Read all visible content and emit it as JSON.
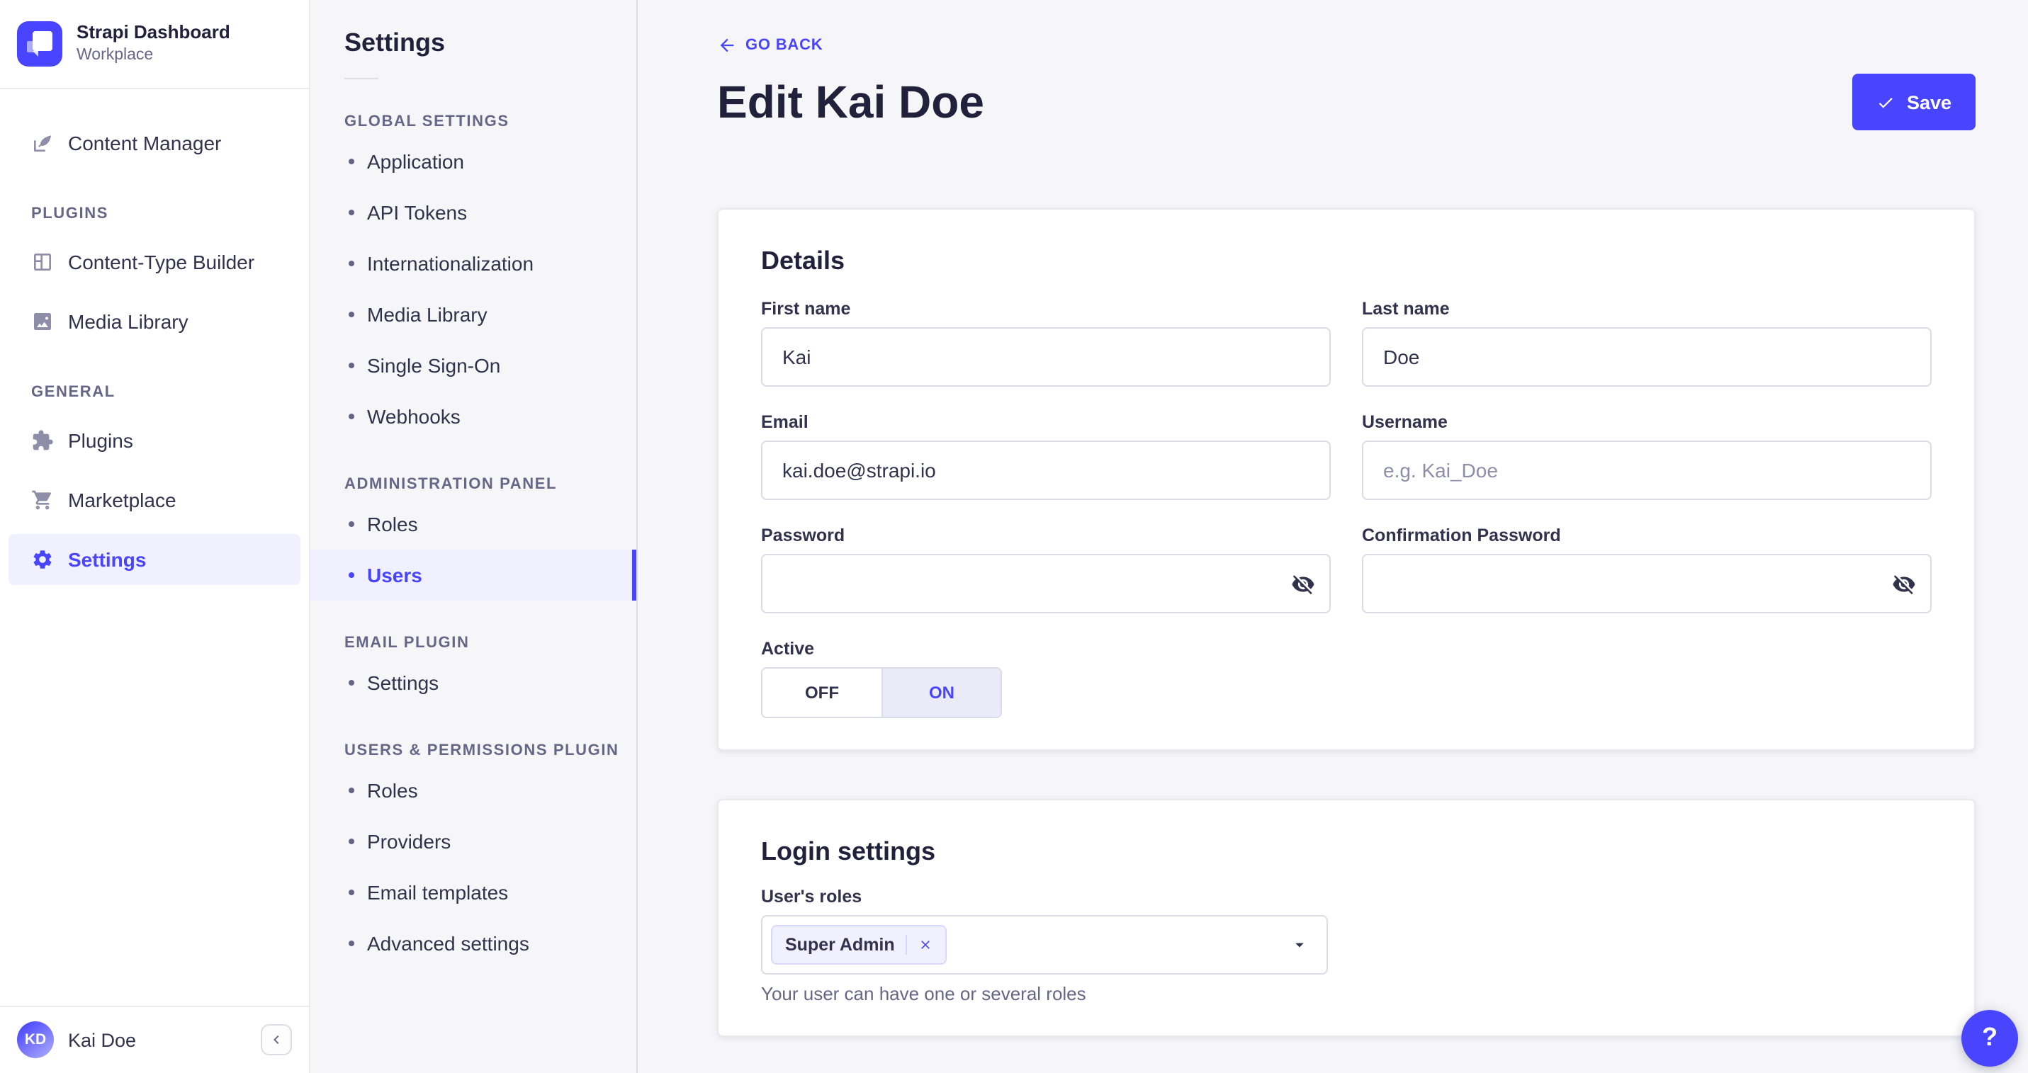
{
  "colors": {
    "primary": "#4945FF",
    "primary_light": "#F0F0FF",
    "text_dark": "#21213B",
    "text": "#32324D",
    "text_muted": "#666687",
    "border": "#DCDCE4",
    "background": "#F6F6F9"
  },
  "sidebar": {
    "brand": {
      "title": "Strapi Dashboard",
      "subtitle": "Workplace"
    },
    "top_items": [
      {
        "label": "Content Manager"
      }
    ],
    "sections": [
      {
        "title": "PLUGINS",
        "items": [
          {
            "label": "Content-Type Builder"
          },
          {
            "label": "Media Library"
          }
        ]
      },
      {
        "title": "GENERAL",
        "items": [
          {
            "label": "Plugins"
          },
          {
            "label": "Marketplace"
          },
          {
            "label": "Settings"
          }
        ]
      }
    ],
    "user": {
      "initials": "KD",
      "name": "Kai Doe"
    }
  },
  "subnav": {
    "title": "Settings",
    "sections": [
      {
        "title": "GLOBAL SETTINGS",
        "items": [
          {
            "label": "Application"
          },
          {
            "label": "API Tokens"
          },
          {
            "label": "Internationalization"
          },
          {
            "label": "Media Library"
          },
          {
            "label": "Single Sign-On"
          },
          {
            "label": "Webhooks"
          }
        ]
      },
      {
        "title": "ADMINISTRATION PANEL",
        "items": [
          {
            "label": "Roles"
          },
          {
            "label": "Users"
          }
        ]
      },
      {
        "title": "EMAIL PLUGIN",
        "items": [
          {
            "label": "Settings"
          }
        ]
      },
      {
        "title": "USERS & PERMISSIONS PLUGIN",
        "items": [
          {
            "label": "Roles"
          },
          {
            "label": "Providers"
          },
          {
            "label": "Email templates"
          },
          {
            "label": "Advanced settings"
          }
        ]
      }
    ]
  },
  "header": {
    "back_label": "GO BACK",
    "title": "Edit Kai Doe",
    "save_label": "Save"
  },
  "details": {
    "title": "Details",
    "fields": [
      {
        "label": "First name",
        "value": "Kai"
      },
      {
        "label": "Last name",
        "value": "Doe"
      },
      {
        "label": "Email",
        "value": "kai.doe@strapi.io"
      },
      {
        "label": "Username",
        "value": "",
        "placeholder": "e.g. Kai_Doe"
      },
      {
        "label": "Password",
        "value": ""
      },
      {
        "label": "Confirmation Password",
        "value": ""
      }
    ],
    "active_field": {
      "label": "Active",
      "off": "OFF",
      "on": "ON",
      "value": "ON"
    }
  },
  "login_settings": {
    "title": "Login settings",
    "roles_label": "User's roles",
    "selected_roles": [
      {
        "name": "Super Admin"
      }
    ],
    "hint": "Your user can have one or several roles"
  },
  "help": {
    "label": "?"
  }
}
